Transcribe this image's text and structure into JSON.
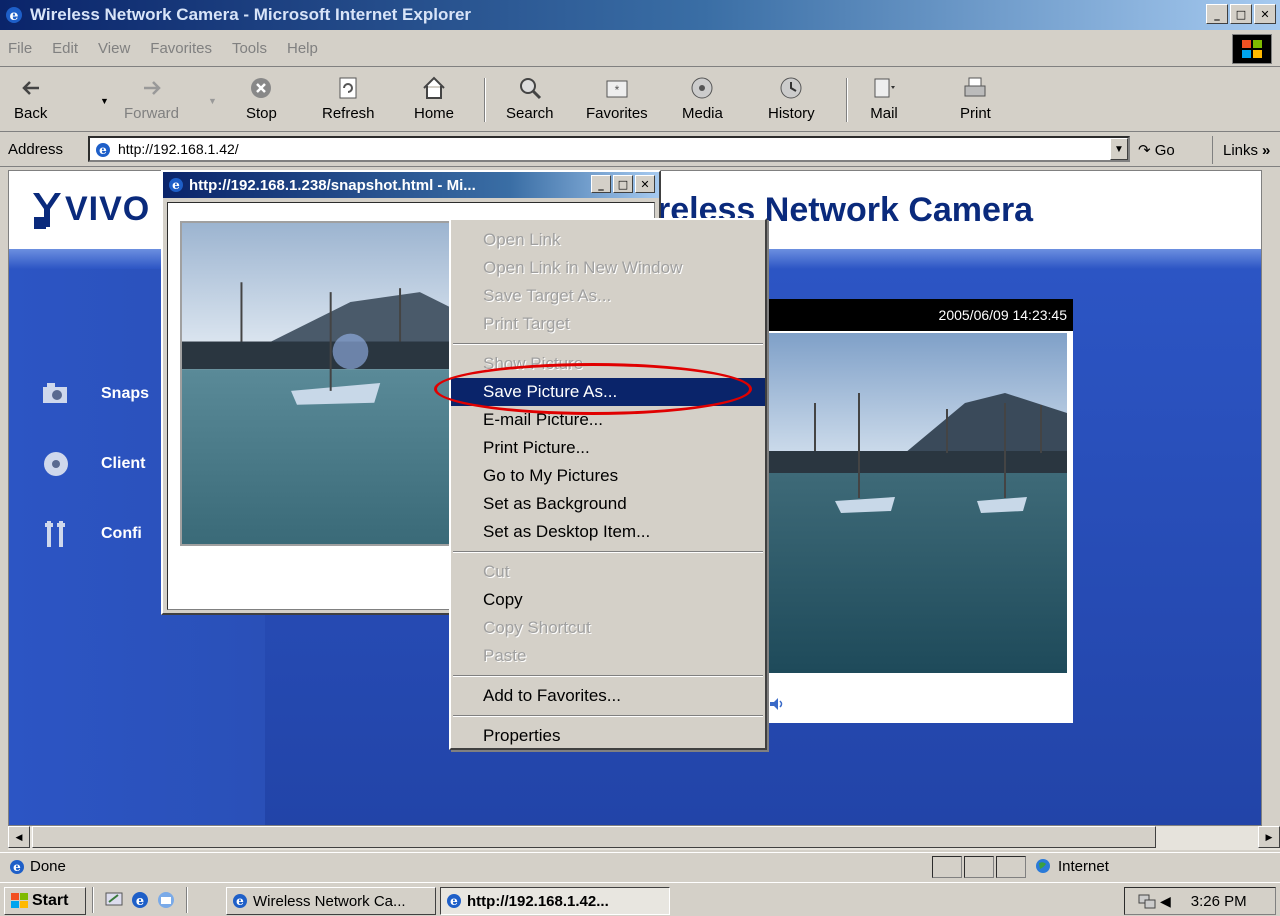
{
  "window": {
    "title": "Wireless Network Camera - Microsoft Internet Explorer",
    "minimize": "_",
    "maximize": "□",
    "close": "✕"
  },
  "menubar": {
    "items": [
      "File",
      "Edit",
      "View",
      "Favorites",
      "Tools",
      "Help"
    ]
  },
  "toolbar": {
    "back": "Back",
    "forward": "Forward",
    "stop": "Stop",
    "refresh": "Refresh",
    "home": "Home",
    "search": "Search",
    "favorites": "Favorites",
    "media": "Media",
    "history": "History",
    "mail": "Mail",
    "print": "Print"
  },
  "addressbar": {
    "label": "Address",
    "url": "http://192.168.1.42/",
    "go": "Go",
    "links": "Links"
  },
  "page": {
    "logo_text": "VIVO",
    "title_fragment": "reless Network Camera",
    "nav": {
      "snapshot": "Snaps",
      "client": "Client",
      "config": "Confi"
    },
    "live_timestamp": "2005/06/09 14:23:45"
  },
  "popup": {
    "title": "http://192.168.1.238/snapshot.html - Mi..."
  },
  "context_menu": {
    "items": [
      {
        "label": "Open Link",
        "disabled": true
      },
      {
        "label": "Open Link in New Window",
        "disabled": true
      },
      {
        "label": "Save Target As...",
        "disabled": true
      },
      {
        "label": "Print Target",
        "disabled": true
      },
      {
        "label": "Show Picture",
        "disabled": true
      },
      {
        "label": "Save Picture As...",
        "disabled": false,
        "highlighted": true
      },
      {
        "label": "E-mail Picture...",
        "disabled": false
      },
      {
        "label": "Print Picture...",
        "disabled": false
      },
      {
        "label": "Go to My Pictures",
        "disabled": false
      },
      {
        "label": "Set as Background",
        "disabled": false
      },
      {
        "label": "Set as Desktop Item...",
        "disabled": false
      },
      {
        "label": "Cut",
        "disabled": true
      },
      {
        "label": "Copy",
        "disabled": false
      },
      {
        "label": "Copy Shortcut",
        "disabled": true
      },
      {
        "label": "Paste",
        "disabled": true
      },
      {
        "label": "Add to Favorites...",
        "disabled": false
      },
      {
        "label": "Properties",
        "disabled": false
      }
    ]
  },
  "statusbar": {
    "text": "Done",
    "zone": "Internet"
  },
  "taskbar": {
    "start": "Start",
    "task1": "Wireless Network Ca...",
    "task2": "http://192.168.1.42...",
    "clock": "3:26 PM"
  },
  "colors": {
    "title_active": "#0a246a",
    "page_blue": "#2c55c4",
    "highlight": "#0a246a",
    "annotation": "#e00000"
  }
}
